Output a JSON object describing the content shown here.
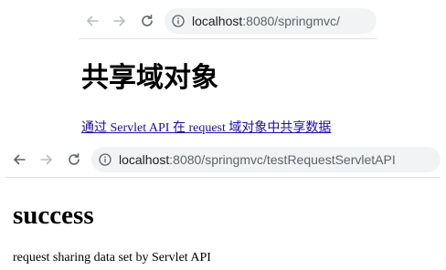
{
  "window1": {
    "url_host": "localhost",
    "url_rest": ":8080/springmvc/",
    "back_icon": "arrow-left-icon",
    "forward_icon": "arrow-right-icon",
    "reload_icon": "reload-icon",
    "info_icon": "info-icon",
    "heading": "共享域对象",
    "link_text": "通过 Servlet API 在 request 域对象中共享数据"
  },
  "window2": {
    "url_host": "localhost",
    "url_rest": ":8080/springmvc/testRequestServletAPI",
    "back_icon": "arrow-left-icon",
    "forward_icon": "arrow-right-icon",
    "reload_icon": "reload-icon",
    "info_icon": "info-icon",
    "heading": "success",
    "message": "request sharing data set by Servlet API"
  },
  "colors": {
    "link": "#1a0dab",
    "url_bar_bg": "#f1f3f4",
    "icon_gray": "#5f6368"
  }
}
